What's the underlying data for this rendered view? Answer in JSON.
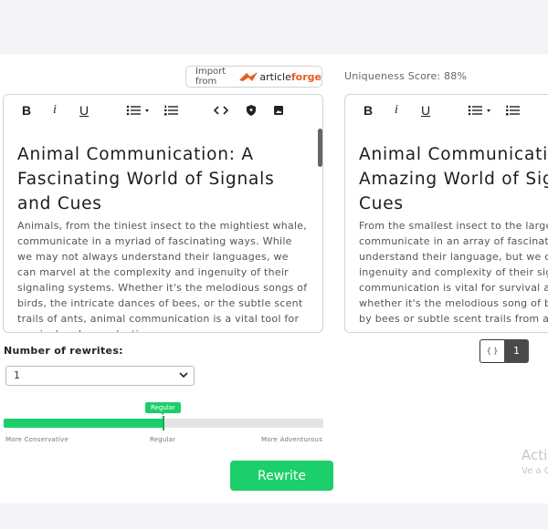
{
  "import": {
    "from_label": "Import from",
    "brand_article": "article",
    "brand_forge": "forge"
  },
  "uniqueness": {
    "label": "Uniqueness Score: 88%",
    "value_percent": 88
  },
  "toolbar_icons": [
    "bold-icon",
    "italic-icon",
    "underline-icon",
    "bullet-list-icon",
    "numbered-list-icon",
    "code-icon",
    "shield-icon",
    "image-icon"
  ],
  "toolbar": {
    "bold": "B",
    "italic": "i",
    "underline": "U"
  },
  "original": {
    "title": "Animal Communication: A Fascinating World of Signals and Cues",
    "body": "Animals, from the tiniest insect to the mightiest whale, communicate in a myriad of fascinating ways. While we may not always understand their languages, we can marvel at the complexity and ingenuity of their signaling systems. Whether it's the melodious songs of birds, the intricate dances of bees, or the subtle scent trails of ants, animal communication is a vital tool for survival and reproduction."
  },
  "rewrite": {
    "title_lines": [
      "Animal Communicati",
      "Amazing World of Sig",
      "Cues"
    ],
    "body_lines": [
      "From the smallest insect to the largest",
      "communicate in an array of fascinating",
      "understand their language, but we can",
      "ingenuity and complexity of their signaling s",
      "communication is vital for survival and",
      "whether it's the melodious song of bird",
      "by bees or subtle scent trails from ants"
    ]
  },
  "rewrites": {
    "label": "Number of rewrites:",
    "selected": "1"
  },
  "slider": {
    "tag": "Regular",
    "value_fraction": 0.5,
    "labels": {
      "left": "More Conservative",
      "mid": "Regular",
      "right": "More Adventurous"
    },
    "fill_color": "#1ccf6a"
  },
  "rewrite_button": {
    "label": "Rewrite"
  },
  "pager": {
    "braces": "{ }",
    "page": "1"
  },
  "watermark": {
    "line1": "Activ",
    "line2": "Ve a C"
  },
  "colors": {
    "accent": "#1ccf6a",
    "brand_orange": "#e85d1f"
  }
}
